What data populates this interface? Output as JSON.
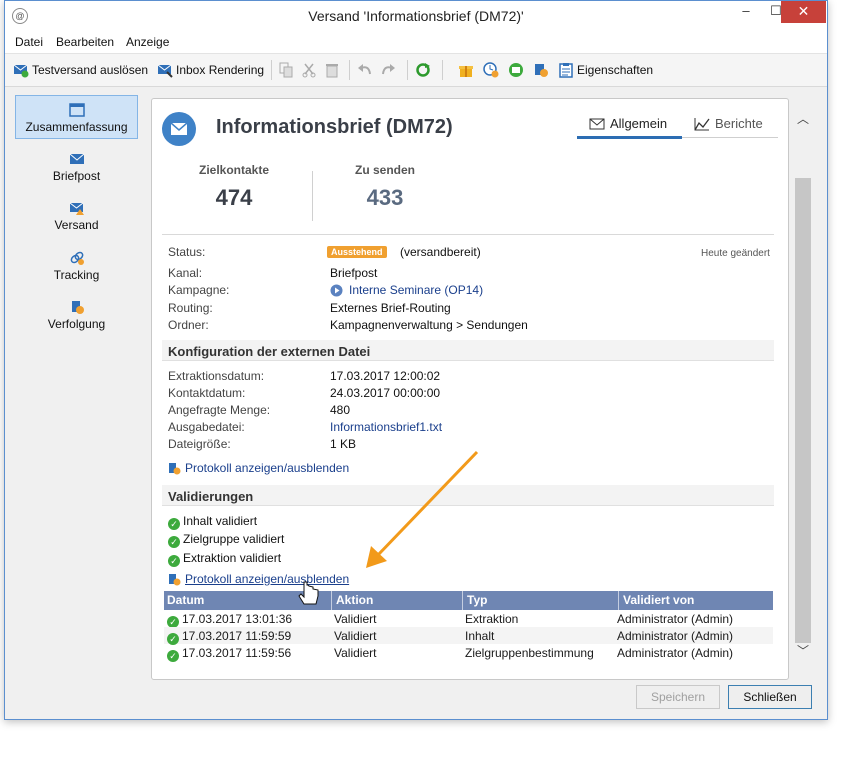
{
  "window": {
    "title": "Versand 'Informationsbrief (DM72)'",
    "minimize": "–",
    "maximize": "☐",
    "close": "✕"
  },
  "menu": [
    "Datei",
    "Bearbeiten",
    "Anzeige"
  ],
  "toolbar": {
    "test_send": "Testversand auslösen",
    "inbox_rendering": "Inbox Rendering",
    "properties": "Eigenschaften"
  },
  "sidebar": [
    {
      "label": "Zusammenfassung",
      "icon": "summary-icon"
    },
    {
      "label": "Briefpost",
      "icon": "mail-icon"
    },
    {
      "label": "Versand",
      "icon": "send-icon"
    },
    {
      "label": "Tracking",
      "icon": "tracking-icon"
    },
    {
      "label": "Verfolgung",
      "icon": "followup-icon"
    }
  ],
  "header": {
    "title": "Informationsbrief (DM72)",
    "tab_general": "Allgemein",
    "tab_reports": "Berichte"
  },
  "kpis": [
    {
      "label": "Zielkontakte",
      "value": "474",
      "color": "#3a3f48"
    },
    {
      "label": "Zu senden",
      "value": "433",
      "color": "#5a6a80"
    }
  ],
  "summary": {
    "status_label": "Status:",
    "status_badge": "Ausstehend",
    "status_text": "(versandbereit)",
    "modified": "Heute geändert",
    "channel_label": "Kanal:",
    "channel": "Briefpost",
    "campaign_label": "Kampagne:",
    "campaign": "Interne Seminare (OP14)",
    "routing_label": "Routing:",
    "routing": "Externes Brief-Routing",
    "folder_label": "Ordner:",
    "folder": "Kampagnenverwaltung > Sendungen"
  },
  "external_file": {
    "title": "Konfiguration der externen Datei",
    "rows": [
      {
        "label": "Extraktionsdatum:",
        "value": "17.03.2017 12:00:02"
      },
      {
        "label": "Kontaktdatum:",
        "value": "24.03.2017 00:00:00"
      },
      {
        "label": "Angefragte Menge:",
        "value": "480"
      },
      {
        "label": "Ausgabedatei:",
        "value": "Informationsbrief1.txt"
      },
      {
        "label": "Dateigröße:",
        "value": "1 KB"
      }
    ],
    "log_link": "Protokoll anzeigen/ausblenden"
  },
  "validations": {
    "title": "Validierungen",
    "items": [
      "Inhalt validiert",
      "Zielgruppe validiert",
      "Extraktion validiert"
    ],
    "log_link": "Protokoll anzeigen/ausblenden",
    "columns": [
      "Datum",
      "Aktion",
      "Typ",
      "Validiert von"
    ],
    "rows": [
      [
        "17.03.2017 13:01:36",
        "Validiert",
        "Extraktion",
        "Administrator (Admin)"
      ],
      [
        "17.03.2017 11:59:59",
        "Validiert",
        "Inhalt",
        "Administrator (Admin)"
      ],
      [
        "17.03.2017 11:59:56",
        "Validiert",
        "Zielgruppenbestimmung",
        "Administrator (Admin)"
      ]
    ]
  },
  "buttons": {
    "save": "Speichern",
    "close": "Schließen"
  },
  "colors": {
    "accent": "#2c6db3",
    "badge": "#f0a030",
    "check": "#3daa3d",
    "annotation_arrow": "#f29a1a",
    "table_header": "#6f86b3"
  }
}
